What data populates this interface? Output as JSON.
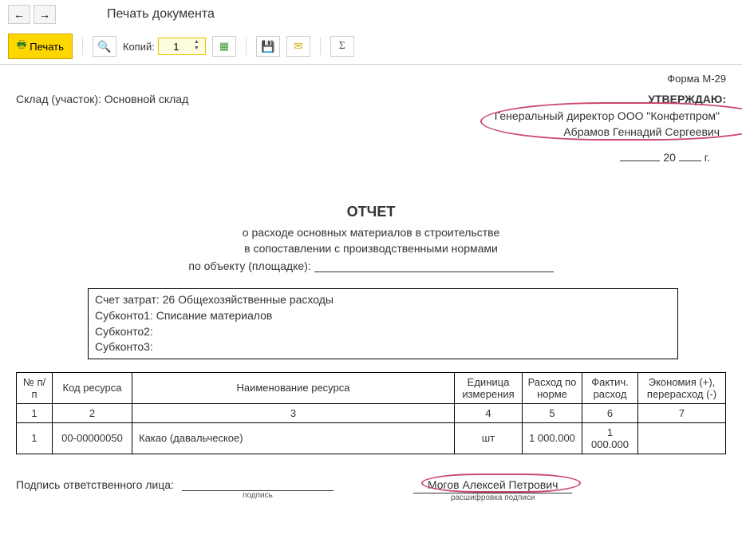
{
  "nav": {
    "title": "Печать документа"
  },
  "toolbar": {
    "print_label": "Печать",
    "copies_label": "Копий:",
    "copies_value": "1"
  },
  "doc": {
    "form_label": "Форма М-29",
    "warehouse_label": "Склад (участок):",
    "warehouse_value": "Основной склад",
    "approve_title": "УТВЕРЖДАЮ:",
    "director_title": "Генеральный директор ООО \"Конфетпром\"",
    "director_name": "Абрамов Геннадий Сергеевич",
    "date_20": "20",
    "date_g": "г.",
    "report_title": "ОТЧЕТ",
    "report_sub1": "о расходе основных материалов в строительстве",
    "report_sub2": "в сопоставлении с производственными нормами",
    "object_label": "по объекту (площадке):",
    "account": {
      "line1_label": "Счет затрат:",
      "line1_value": "26 Общехозяйственные расходы",
      "line2_label": "Субконто1:",
      "line2_value": "Списание материалов",
      "line3_label": "Субконто2:",
      "line3_value": "",
      "line4_label": "Субконто3:",
      "line4_value": ""
    },
    "table": {
      "headers": {
        "num": "№ п/п",
        "code": "Код ресурса",
        "name": "Наименование ресурса",
        "unit": "Единица измерения",
        "norm": "Расход по норме",
        "fact": "Фактич. расход",
        "econ": "Экономия (+), перерасход (-)"
      },
      "colnums": [
        "1",
        "2",
        "3",
        "4",
        "5",
        "6",
        "7"
      ],
      "rows": [
        {
          "num": "1",
          "code": "00-00000050",
          "name": "Какао (давальческое)",
          "unit": "шт",
          "norm": "1 000.000",
          "fact": "1 000.000",
          "econ": ""
        }
      ]
    },
    "signature": {
      "label": "Подпись ответственного лица:",
      "hint1": "подпись",
      "name": "Могов Алексей Петрович",
      "hint2": "расшифровка подписи"
    }
  }
}
